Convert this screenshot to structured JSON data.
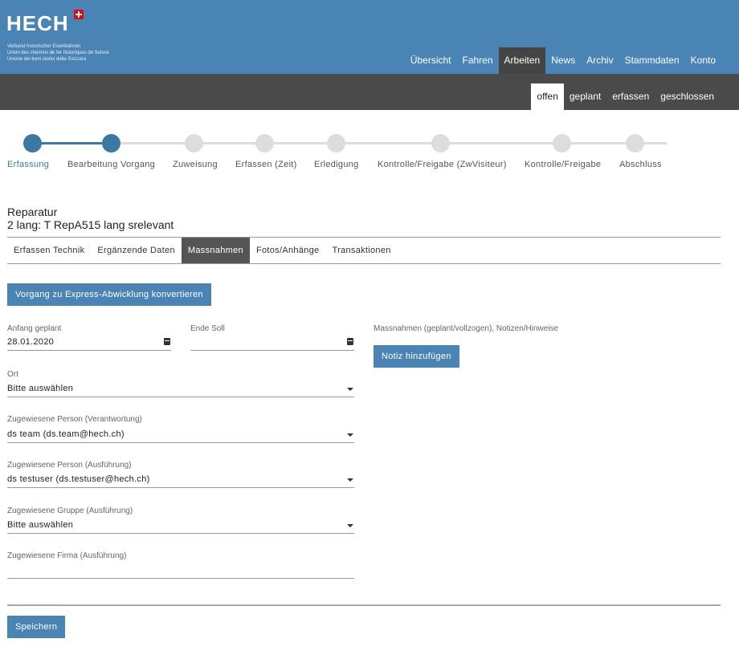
{
  "header": {
    "logo": "HECH",
    "tagline": [
      "Verband historischer Eisenbahnen",
      "Union des chemins de fer historiques de Suisse",
      "Unione dei treni storici della Svizzera"
    ],
    "nav": [
      {
        "label": "Übersicht",
        "active": false
      },
      {
        "label": "Fahren",
        "active": false
      },
      {
        "label": "Arbeiten",
        "active": true
      },
      {
        "label": "News",
        "active": false
      },
      {
        "label": "Archiv",
        "active": false
      },
      {
        "label": "Stammdaten",
        "active": false
      },
      {
        "label": "Konto",
        "active": false
      }
    ]
  },
  "subnav": [
    {
      "label": "offen",
      "active": true
    },
    {
      "label": "geplant",
      "active": false
    },
    {
      "label": "erfassen",
      "active": false
    },
    {
      "label": "geschlossen",
      "active": false
    }
  ],
  "stepper": {
    "completed_count": 2,
    "steps": [
      "Erfassung",
      "Bearbeitung Vorgang",
      "Zuweisung",
      "Erfassen (Zeit)",
      "Erledigung",
      "Kontrolle/Freigabe (ZwVisiteur)",
      "Kontrolle/Freigabe",
      "Abschluss"
    ]
  },
  "title": {
    "type": "Reparatur",
    "name": "2 lang: T RepA515 lang srelevant"
  },
  "tabs": [
    {
      "label": "Erfassen Technik",
      "active": false
    },
    {
      "label": "Ergänzende Daten",
      "active": false
    },
    {
      "label": "Massnahmen",
      "active": true
    },
    {
      "label": "Fotos/Anhänge",
      "active": false
    },
    {
      "label": "Transaktionen",
      "active": false
    }
  ],
  "form": {
    "express_button": "Vorgang zu Express-Abwicklung konvertieren",
    "anfang_label": "Anfang geplant",
    "anfang_value": "28.01.2020",
    "ende_label": "Ende Soll",
    "ende_value": "",
    "ort_label": "Ort",
    "ort_value": "Bitte auswählen",
    "person_verantwortung_label": "Zugewiesene Person (Verantwortung)",
    "person_verantwortung_value": "ds team (ds.team@hech.ch)",
    "person_ausfuehrung_label": "Zugewiesene Person (Ausführung)",
    "person_ausfuehrung_value": "ds testuser (ds.testuser@hech.ch)",
    "gruppe_label": "Zugewiesene Gruppe (Ausführung)",
    "gruppe_value": "Bitte auswählen",
    "firma_label": "Zugewiesene Firma (Ausführung)",
    "firma_value": "",
    "massnahmen_label": "Massnahmen (geplant/vollzogen), Notizen/Hinweise",
    "notiz_button": "Notiz hinzufügen",
    "save_button": "Speichern"
  }
}
